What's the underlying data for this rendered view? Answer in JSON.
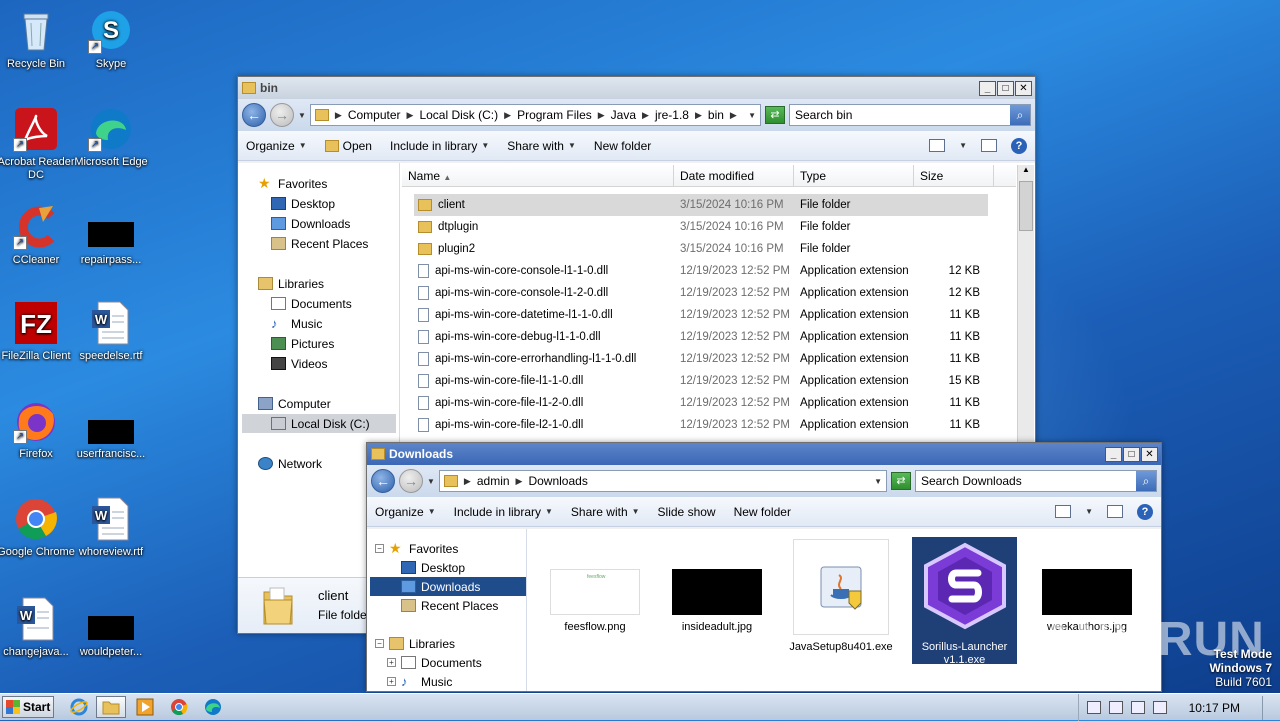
{
  "desktop": {
    "icons": [
      {
        "label": "Recycle Bin"
      },
      {
        "label": "Skype"
      },
      {
        "label": "Acrobat Reader DC"
      },
      {
        "label": "Microsoft Edge"
      },
      {
        "label": "CCleaner"
      },
      {
        "label": "repairpass..."
      },
      {
        "label": "FileZilla Client"
      },
      {
        "label": "speedelse.rtf"
      },
      {
        "label": "Firefox"
      },
      {
        "label": "userfrancisc..."
      },
      {
        "label": "Google Chrome"
      },
      {
        "label": "whoreview.rtf"
      },
      {
        "label": "changejava..."
      },
      {
        "label": "wouldpeter..."
      }
    ]
  },
  "bin_window": {
    "title": "bin",
    "breadcrumb": [
      "Computer",
      "Local Disk (C:)",
      "Program Files",
      "Java",
      "jre-1.8",
      "bin"
    ],
    "search_placeholder": "Search bin",
    "toolbar": {
      "organize": "Organize",
      "open": "Open",
      "include": "Include in library",
      "share": "Share with",
      "new_folder": "New folder"
    },
    "nav": {
      "favorites": "Favorites",
      "desktop": "Desktop",
      "downloads": "Downloads",
      "recent": "Recent Places",
      "libraries": "Libraries",
      "documents": "Documents",
      "music": "Music",
      "pictures": "Pictures",
      "videos": "Videos",
      "computer": "Computer",
      "local_disk": "Local Disk (C:)",
      "network": "Network"
    },
    "columns": {
      "name": "Name",
      "date": "Date modified",
      "type": "Type",
      "size": "Size"
    },
    "rows": [
      {
        "name": "client",
        "date": "3/15/2024 10:16 PM",
        "type": "File folder",
        "size": ""
      },
      {
        "name": "dtplugin",
        "date": "3/15/2024 10:16 PM",
        "type": "File folder",
        "size": ""
      },
      {
        "name": "plugin2",
        "date": "3/15/2024 10:16 PM",
        "type": "File folder",
        "size": ""
      },
      {
        "name": "api-ms-win-core-console-l1-1-0.dll",
        "date": "12/19/2023 12:52 PM",
        "type": "Application extension",
        "size": "12 KB"
      },
      {
        "name": "api-ms-win-core-console-l1-2-0.dll",
        "date": "12/19/2023 12:52 PM",
        "type": "Application extension",
        "size": "12 KB"
      },
      {
        "name": "api-ms-win-core-datetime-l1-1-0.dll",
        "date": "12/19/2023 12:52 PM",
        "type": "Application extension",
        "size": "11 KB"
      },
      {
        "name": "api-ms-win-core-debug-l1-1-0.dll",
        "date": "12/19/2023 12:52 PM",
        "type": "Application extension",
        "size": "11 KB"
      },
      {
        "name": "api-ms-win-core-errorhandling-l1-1-0.dll",
        "date": "12/19/2023 12:52 PM",
        "type": "Application extension",
        "size": "11 KB"
      },
      {
        "name": "api-ms-win-core-file-l1-1-0.dll",
        "date": "12/19/2023 12:52 PM",
        "type": "Application extension",
        "size": "15 KB"
      },
      {
        "name": "api-ms-win-core-file-l1-2-0.dll",
        "date": "12/19/2023 12:52 PM",
        "type": "Application extension",
        "size": "11 KB"
      },
      {
        "name": "api-ms-win-core-file-l2-1-0.dll",
        "date": "12/19/2023 12:52 PM",
        "type": "Application extension",
        "size": "11 KB"
      }
    ],
    "details": {
      "name": "client",
      "type": "File folder"
    }
  },
  "downloads_window": {
    "title": "Downloads",
    "breadcrumb": [
      "admin",
      "Downloads"
    ],
    "search_placeholder": "Search Downloads",
    "toolbar": {
      "organize": "Organize",
      "include": "Include in library",
      "share": "Share with",
      "slideshow": "Slide show",
      "new_folder": "New folder"
    },
    "nav": {
      "favorites": "Favorites",
      "desktop": "Desktop",
      "downloads": "Downloads",
      "recent": "Recent Places",
      "libraries": "Libraries",
      "documents": "Documents",
      "music": "Music"
    },
    "files": [
      {
        "name": "feesflow.png",
        "thumb_text": "feesflow"
      },
      {
        "name": "insideadult.jpg"
      },
      {
        "name": "JavaSetup8u401.exe"
      },
      {
        "name": "Sorillus-Launcher v1.1.exe"
      },
      {
        "name": "weekauthors.jpg"
      }
    ]
  },
  "taskbar": {
    "start": "Start",
    "clock": "10:17 PM"
  },
  "watermark": {
    "line1": "Test Mode",
    "line2": "Windows 7",
    "line3": "Build 7601",
    "brand": "ANY RUN"
  },
  "colors": {
    "accent": "#1f4d8c",
    "desktop": "#1d66c0",
    "sorillus": "#7a3bd6"
  }
}
